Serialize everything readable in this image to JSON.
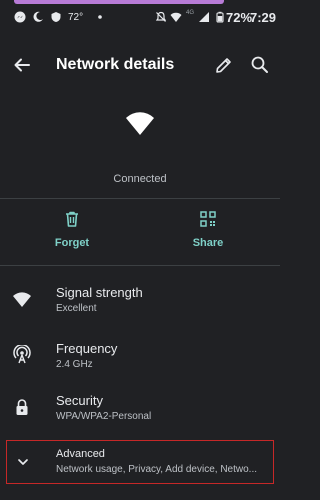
{
  "status_bar": {
    "temperature": "72°",
    "network_label": "4G",
    "battery": "72%",
    "time": "7:29",
    "icons": [
      "messenger-icon",
      "moon-icon",
      "shield-icon",
      "dot-icon",
      "mute-icon",
      "wifi-icon",
      "signal-icon",
      "battery-icon"
    ]
  },
  "app_bar": {
    "title": "Network details",
    "icons": [
      "back-arrow-icon",
      "edit-pencil-icon",
      "search-icon"
    ]
  },
  "network": {
    "status": "Connected",
    "icon": "wifi-icon"
  },
  "actions": [
    {
      "label": "Forget",
      "icon": "trash-icon"
    },
    {
      "label": "Share",
      "icon": "qr-code-icon"
    }
  ],
  "details": [
    {
      "title": "Signal strength",
      "value": "Excellent",
      "icon": "wifi-icon"
    },
    {
      "title": "Frequency",
      "value": "2.4 GHz",
      "icon": "antenna-icon"
    },
    {
      "title": "Security",
      "value": "WPA/WPA2-Personal",
      "icon": "lock-icon"
    }
  ],
  "advanced": {
    "title": "Advanced",
    "summary": "Network usage, Privacy, Add device, Netwo...",
    "icon": "chevron-down-icon"
  },
  "colors": {
    "background": "#202124",
    "accent": "#7fd1c8",
    "highlight_border": "#c62828",
    "top_bar": "#b77bd6"
  }
}
